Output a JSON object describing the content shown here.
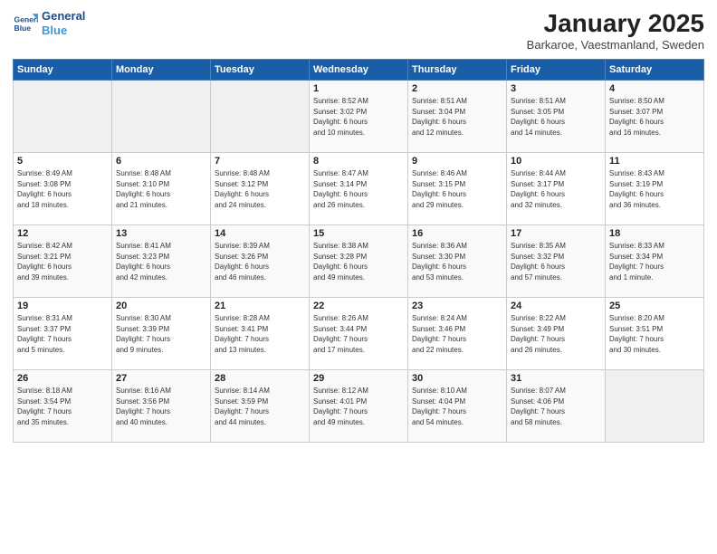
{
  "logo": {
    "line1": "General",
    "line2": "Blue"
  },
  "title": "January 2025",
  "subtitle": "Barkaroe, Vaestmanland, Sweden",
  "days_header": [
    "Sunday",
    "Monday",
    "Tuesday",
    "Wednesday",
    "Thursday",
    "Friday",
    "Saturday"
  ],
  "weeks": [
    [
      {
        "day": "",
        "info": ""
      },
      {
        "day": "",
        "info": ""
      },
      {
        "day": "",
        "info": ""
      },
      {
        "day": "1",
        "info": "Sunrise: 8:52 AM\nSunset: 3:02 PM\nDaylight: 6 hours\nand 10 minutes."
      },
      {
        "day": "2",
        "info": "Sunrise: 8:51 AM\nSunset: 3:04 PM\nDaylight: 6 hours\nand 12 minutes."
      },
      {
        "day": "3",
        "info": "Sunrise: 8:51 AM\nSunset: 3:05 PM\nDaylight: 6 hours\nand 14 minutes."
      },
      {
        "day": "4",
        "info": "Sunrise: 8:50 AM\nSunset: 3:07 PM\nDaylight: 6 hours\nand 16 minutes."
      }
    ],
    [
      {
        "day": "5",
        "info": "Sunrise: 8:49 AM\nSunset: 3:08 PM\nDaylight: 6 hours\nand 18 minutes."
      },
      {
        "day": "6",
        "info": "Sunrise: 8:48 AM\nSunset: 3:10 PM\nDaylight: 6 hours\nand 21 minutes."
      },
      {
        "day": "7",
        "info": "Sunrise: 8:48 AM\nSunset: 3:12 PM\nDaylight: 6 hours\nand 24 minutes."
      },
      {
        "day": "8",
        "info": "Sunrise: 8:47 AM\nSunset: 3:14 PM\nDaylight: 6 hours\nand 26 minutes."
      },
      {
        "day": "9",
        "info": "Sunrise: 8:46 AM\nSunset: 3:15 PM\nDaylight: 6 hours\nand 29 minutes."
      },
      {
        "day": "10",
        "info": "Sunrise: 8:44 AM\nSunset: 3:17 PM\nDaylight: 6 hours\nand 32 minutes."
      },
      {
        "day": "11",
        "info": "Sunrise: 8:43 AM\nSunset: 3:19 PM\nDaylight: 6 hours\nand 36 minutes."
      }
    ],
    [
      {
        "day": "12",
        "info": "Sunrise: 8:42 AM\nSunset: 3:21 PM\nDaylight: 6 hours\nand 39 minutes."
      },
      {
        "day": "13",
        "info": "Sunrise: 8:41 AM\nSunset: 3:23 PM\nDaylight: 6 hours\nand 42 minutes."
      },
      {
        "day": "14",
        "info": "Sunrise: 8:39 AM\nSunset: 3:26 PM\nDaylight: 6 hours\nand 46 minutes."
      },
      {
        "day": "15",
        "info": "Sunrise: 8:38 AM\nSunset: 3:28 PM\nDaylight: 6 hours\nand 49 minutes."
      },
      {
        "day": "16",
        "info": "Sunrise: 8:36 AM\nSunset: 3:30 PM\nDaylight: 6 hours\nand 53 minutes."
      },
      {
        "day": "17",
        "info": "Sunrise: 8:35 AM\nSunset: 3:32 PM\nDaylight: 6 hours\nand 57 minutes."
      },
      {
        "day": "18",
        "info": "Sunrise: 8:33 AM\nSunset: 3:34 PM\nDaylight: 7 hours\nand 1 minute."
      }
    ],
    [
      {
        "day": "19",
        "info": "Sunrise: 8:31 AM\nSunset: 3:37 PM\nDaylight: 7 hours\nand 5 minutes."
      },
      {
        "day": "20",
        "info": "Sunrise: 8:30 AM\nSunset: 3:39 PM\nDaylight: 7 hours\nand 9 minutes."
      },
      {
        "day": "21",
        "info": "Sunrise: 8:28 AM\nSunset: 3:41 PM\nDaylight: 7 hours\nand 13 minutes."
      },
      {
        "day": "22",
        "info": "Sunrise: 8:26 AM\nSunset: 3:44 PM\nDaylight: 7 hours\nand 17 minutes."
      },
      {
        "day": "23",
        "info": "Sunrise: 8:24 AM\nSunset: 3:46 PM\nDaylight: 7 hours\nand 22 minutes."
      },
      {
        "day": "24",
        "info": "Sunrise: 8:22 AM\nSunset: 3:49 PM\nDaylight: 7 hours\nand 26 minutes."
      },
      {
        "day": "25",
        "info": "Sunrise: 8:20 AM\nSunset: 3:51 PM\nDaylight: 7 hours\nand 30 minutes."
      }
    ],
    [
      {
        "day": "26",
        "info": "Sunrise: 8:18 AM\nSunset: 3:54 PM\nDaylight: 7 hours\nand 35 minutes."
      },
      {
        "day": "27",
        "info": "Sunrise: 8:16 AM\nSunset: 3:56 PM\nDaylight: 7 hours\nand 40 minutes."
      },
      {
        "day": "28",
        "info": "Sunrise: 8:14 AM\nSunset: 3:59 PM\nDaylight: 7 hours\nand 44 minutes."
      },
      {
        "day": "29",
        "info": "Sunrise: 8:12 AM\nSunset: 4:01 PM\nDaylight: 7 hours\nand 49 minutes."
      },
      {
        "day": "30",
        "info": "Sunrise: 8:10 AM\nSunset: 4:04 PM\nDaylight: 7 hours\nand 54 minutes."
      },
      {
        "day": "31",
        "info": "Sunrise: 8:07 AM\nSunset: 4:06 PM\nDaylight: 7 hours\nand 58 minutes."
      },
      {
        "day": "",
        "info": ""
      }
    ]
  ]
}
